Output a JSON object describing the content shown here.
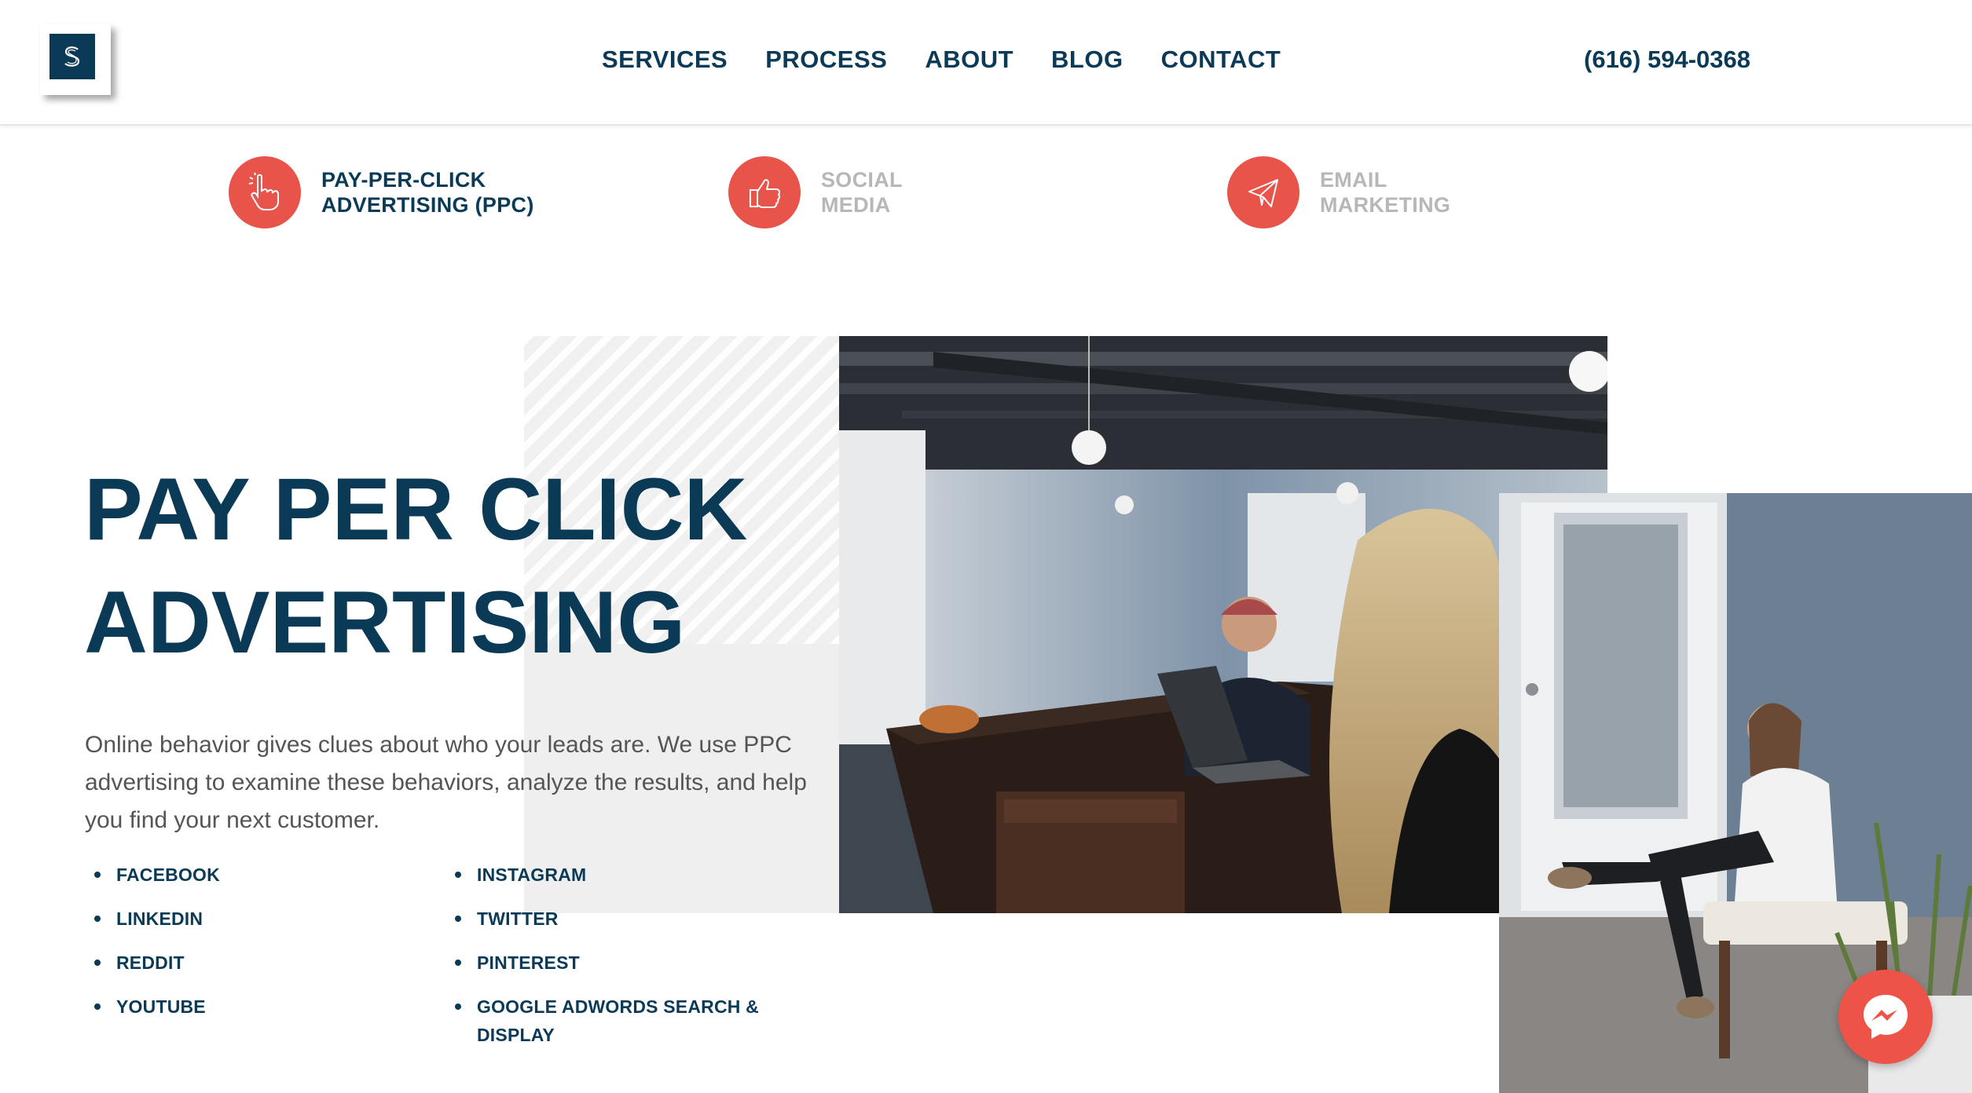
{
  "header": {
    "logo_letter": "S",
    "nav": [
      "SERVICES",
      "PROCESS",
      "ABOUT",
      "BLOG",
      "CONTACT"
    ],
    "phone": "(616) 594-0368"
  },
  "services": [
    {
      "line1": "PAY-PER-CLICK",
      "line2": "ADVERTISING (PPC)",
      "icon": "pointing-hand-icon",
      "active": true
    },
    {
      "line1": "SOCIAL",
      "line2": "MEDIA",
      "icon": "thumbs-up-icon",
      "active": false
    },
    {
      "line1": "EMAIL",
      "line2": "MARKETING",
      "icon": "paper-plane-icon",
      "active": false
    }
  ],
  "hero": {
    "title_line1": "PAY PER CLICK",
    "title_line2": "ADVERTISING",
    "description": "Online behavior gives clues about who your leads are. We use PPC advertising to examine these behaviors, analyze the results, and help you find your next customer.",
    "platforms_left": [
      "FACEBOOK",
      "LINKEDIN",
      "REDDIT",
      "YOUTUBE"
    ],
    "platforms_right": [
      "INSTAGRAM",
      "TWITTER",
      "PINTEREST",
      "GOOGLE ADWORDS SEARCH & DISPLAY"
    ]
  },
  "colors": {
    "navy": "#0b3a57",
    "accent": "#e8534a",
    "muted": "#b7b7b7"
  },
  "messenger_icon": "messenger-icon"
}
